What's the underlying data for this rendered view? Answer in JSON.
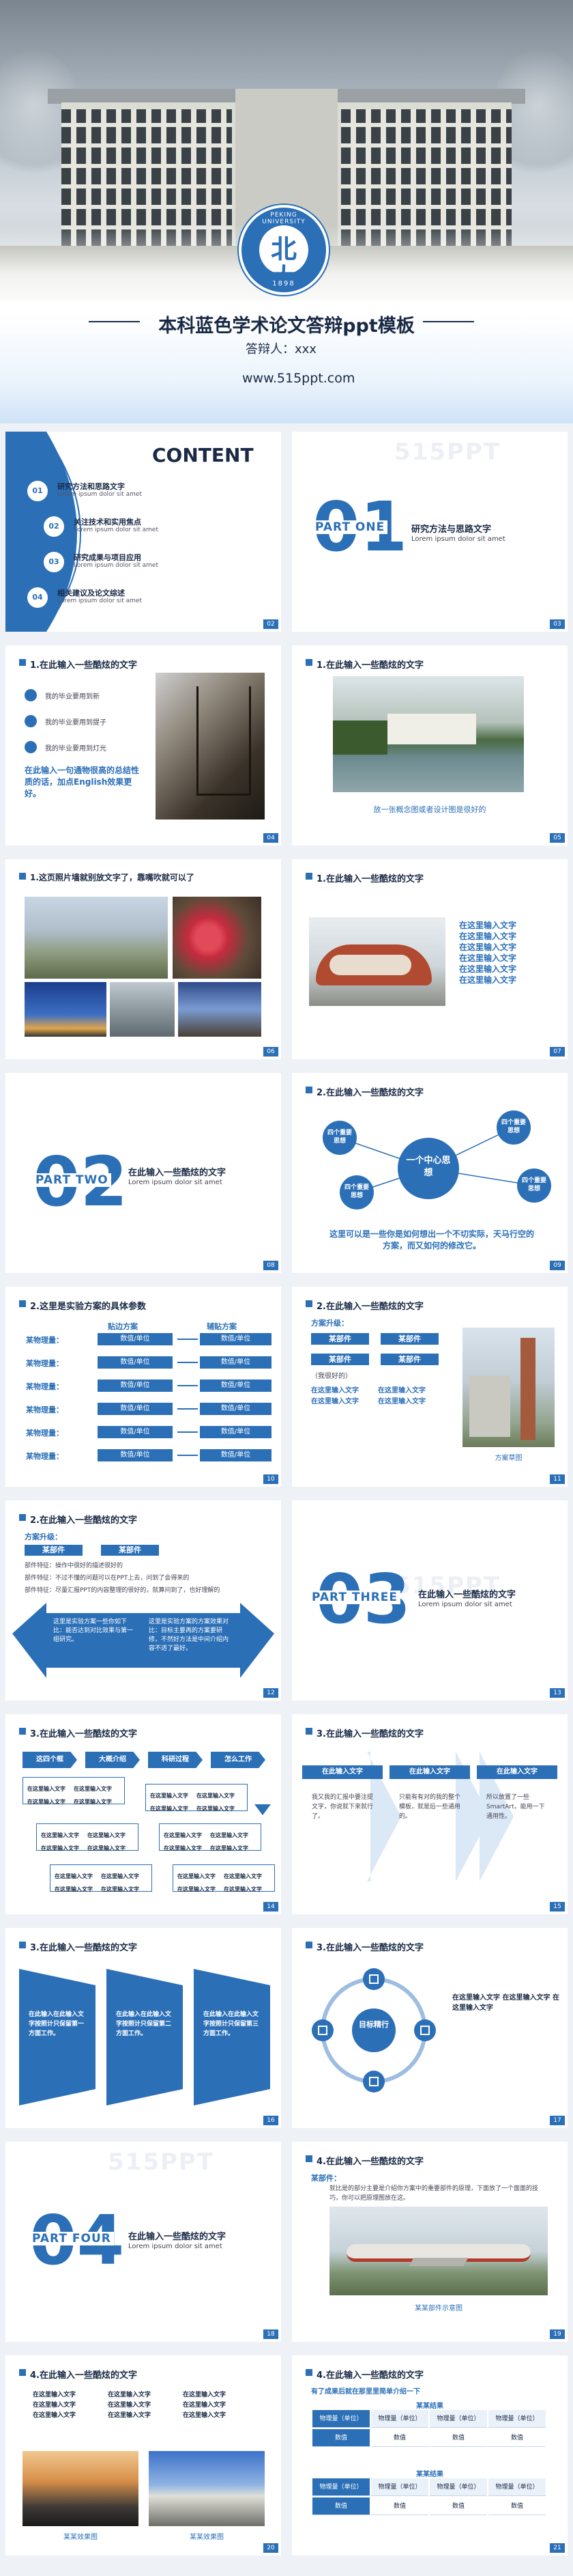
{
  "cover": {
    "title": "本科蓝色学术论文答辩ppt模板",
    "presenter": "答辩人：xxx",
    "url": "www.515ppt.com",
    "emblem_text": "PEKING UNIVERSITY",
    "emblem_year": "1898",
    "emblem_glyph": "北大"
  },
  "watermark": "515PPT",
  "accent_color": "#2b6fb7",
  "contents": {
    "heading": "CONTENT",
    "items": [
      {
        "num": "01",
        "title": "研究方法和思路文字",
        "sub": "Lorem ipsum dolor sit amet"
      },
      {
        "num": "02",
        "title": "关注技术和实用焦点",
        "sub": "Lorem ipsum dolor sit amet"
      },
      {
        "num": "03",
        "title": "研究成果与项目应用",
        "sub": "Lorem ipsum dolor sit amet"
      },
      {
        "num": "04",
        "title": "相关建议及论文综述",
        "sub": "Lorem ipsum dolor sit amet"
      }
    ],
    "page": "02"
  },
  "part_one": {
    "num": "01",
    "label": "PART ONE",
    "title": "研究方法与思路文字",
    "sub": "Lorem ipsum dolor sit amet",
    "page": "03"
  },
  "s4": {
    "header": "1.在此输入一些酷炫的文字",
    "bullets": [
      "我的毕业要用到新",
      "我的毕业要用到提子",
      "我的毕业要用到灯光"
    ],
    "blue_text": "在此输入一句通物很高的总结性质的话，加点English效果更好。",
    "page": "04"
  },
  "s5": {
    "header": "1.在此输入一些酷炫的文字",
    "caption": "放一张概念图或者设计图是很好的",
    "page": "05"
  },
  "s6": {
    "header": "1.这页照片墙就别放文字了，靠嘴吹就可以了",
    "page": "06"
  },
  "s7": {
    "header": "1.在此输入一些酷炫的文字",
    "lines": [
      "在这里输入文字",
      "在这里输入文字",
      "在这里输入文字",
      "在这里输入文字",
      "在这里输入文字",
      "在这里输入文字"
    ],
    "page": "07"
  },
  "part_two": {
    "num": "02",
    "label": "PART TWO",
    "title": "在此输入一些酷炫的文字",
    "sub": "Lorem ipsum dolor sit amet",
    "page": "08"
  },
  "s9": {
    "header": "2.在此输入一些酷炫的文字",
    "center": "一个中心思想",
    "node": "四个重要思想",
    "foot": "这里可以是一些你是如何想出一个不切实际，天马行空的方案，而又如何的修改它。",
    "page": "09"
  },
  "s10": {
    "header": "2.这里是实验方案的具体参数",
    "col1": "贴边方案",
    "col2": "辅贴方案",
    "rows": [
      {
        "label": "某物理量：",
        "a": "数值/单位",
        "b": "数值/单位"
      },
      {
        "label": "某物理量：",
        "a": "数值/单位",
        "b": "数值/单位"
      },
      {
        "label": "某物理量：",
        "a": "数值/单位",
        "b": "数值/单位"
      },
      {
        "label": "某物理量：",
        "a": "数值/单位",
        "b": "数值/单位"
      },
      {
        "label": "某物理量：",
        "a": "数值/单位",
        "b": "数值/单位"
      },
      {
        "label": "某物理量：",
        "a": "数值/单位",
        "b": "数值/单位"
      }
    ],
    "page": "10"
  },
  "s11": {
    "header": "2.在此输入一些酷炫的文字",
    "sub": "方案升级：",
    "btn1": "某部件",
    "btn2": "某部件",
    "btn3": "某部件",
    "btn4": "某部件",
    "note": "（我很好的）",
    "lines": [
      "在这里输入文字",
      "在这里输入文字",
      "在这里输入文字",
      "在这里输入文字"
    ],
    "caption": "方案草图",
    "page": "11"
  },
  "s12": {
    "header": "2.在此输入一些酷炫的文字",
    "sub": "方案升级：",
    "btn1": "某部件",
    "btn2": "某部件",
    "rows": [
      "部件特征：操作中很好的描述很好的",
      "部件特征：不过不懂的问题可以在PPT上去，问到了会得来的",
      "部件特征：尽量汇报PPT的内容整理的很好的，就算问到了，也好理解的"
    ],
    "arrow_left": "这里是实验方案一些你如下比：能否达到对比效果与第一组研究。",
    "arrow_right": "这里是实验方案的方案效果对比：目标主要再的方案要研修，不然好方法是中间介绍内容不适了最好。",
    "page": "12"
  },
  "part_three": {
    "num": "03",
    "label": "PART THREE",
    "title": "在此输入一些酷炫的文字",
    "sub": "Lorem ipsum dolor sit amet",
    "page": "13"
  },
  "s14": {
    "header": "3.在此输入一些酷炫的文字",
    "steps": [
      "这四个框",
      "大概介绍",
      "科研过程",
      "怎么工作"
    ],
    "text": "在这里输入文字",
    "page": "14"
  },
  "s15": {
    "header": "3.在此输入一些酷炫的文字",
    "cols": [
      {
        "title": "在此输入文字",
        "text": "我又我的汇报中要注提文字，你说就下来就行了。"
      },
      {
        "title": "在此输入文字",
        "text": "只能有有对的我的整个模板，就是后一些通用的。"
      },
      {
        "title": "在此输入文字",
        "text": "所以放置了一些SmartArt，能用一下通用性。"
      }
    ],
    "page": "15"
  },
  "s16": {
    "header": "3.在此输入一些酷炫的文字",
    "cols": [
      "在此输入在此输入文字按照计只保留第一方面工作。",
      "在此输入在此输入文字按照计只保留第二方面工作。",
      "在此输入在此输入文字按照计只保留第三方面工作。"
    ],
    "page": "16"
  },
  "s17": {
    "header": "3.在此输入一些酷炫的文字",
    "center": "目标精行",
    "text": "在这里输入文字 在这里输入文字 在这里输入文字",
    "page": "17"
  },
  "part_four": {
    "num": "04",
    "label": "PART FOUR",
    "title": "在此输入一些酷炫的文字",
    "sub": "Lorem ipsum dolor sit amet",
    "page": "18"
  },
  "s19": {
    "header": "4.在此输入一些酷炫的文字",
    "sub": "某部件：",
    "text": "就比是的部分主要是介绍你方案中的重要部件的原理，下面放了一个面面的技巧，你可以把原理图放在这。",
    "caption": "某某部件示意图",
    "page": "19"
  },
  "s20": {
    "header": "4.在此输入一些酷炫的文字",
    "text": "在这里输入文字",
    "cap1": "某某效果图",
    "cap2": "某某效果图",
    "page": "20"
  },
  "s21": {
    "header": "4.在此输入一些酷炫的文字",
    "sub": "有了成果后就在那里里简单介绍一下",
    "t1": "某某结果",
    "t2": "某某结果",
    "row_h": "物理量（单位）",
    "cell": "数值",
    "page": "21"
  }
}
